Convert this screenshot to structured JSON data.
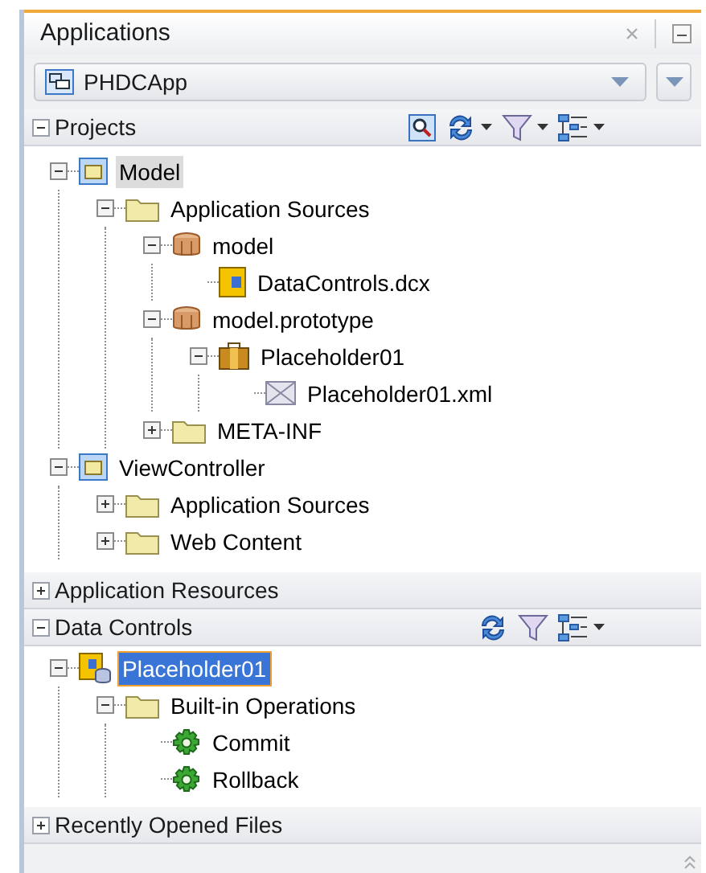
{
  "tab": {
    "title": "Applications"
  },
  "app_selector": {
    "value": "PHDCApp"
  },
  "sections": [
    {
      "title": "Projects",
      "expanded": true,
      "focused": false,
      "toolbar": [
        {
          "kind": "find",
          "menu": false
        },
        {
          "kind": "sync",
          "menu": true
        },
        {
          "kind": "filter",
          "menu": true
        },
        {
          "kind": "layout",
          "menu": true
        }
      ],
      "tree": [
        {
          "label": "Model",
          "kind": "project",
          "expanded": true,
          "selected": true,
          "children": [
            {
              "label": "Application Sources",
              "kind": "folder",
              "expanded": true,
              "selected": false,
              "children": [
                {
                  "label": "model",
                  "kind": "package",
                  "expanded": true,
                  "selected": false,
                  "children": [
                    {
                      "label": "DataControls.dcx",
                      "kind": "dcx",
                      "selected": false
                    }
                  ]
                },
                {
                  "label": "model.prototype",
                  "kind": "package",
                  "expanded": true,
                  "selected": false,
                  "children": [
                    {
                      "label": "Placeholder01",
                      "kind": "business",
                      "expanded": true,
                      "selected": false,
                      "children": [
                        {
                          "label": "Placeholder01.xml",
                          "kind": "xml",
                          "selected": false
                        }
                      ]
                    }
                  ]
                },
                {
                  "label": "META-INF",
                  "kind": "folder",
                  "expanded": false,
                  "selected": false
                }
              ]
            }
          ]
        },
        {
          "label": "ViewController",
          "kind": "project",
          "expanded": true,
          "selected": false,
          "children": [
            {
              "label": "Application Sources",
              "kind": "folder",
              "expanded": false,
              "selected": false
            },
            {
              "label": "Web Content",
              "kind": "folder",
              "expanded": false,
              "selected": false
            }
          ]
        }
      ]
    },
    {
      "title": "Application Resources",
      "expanded": false
    },
    {
      "title": "Data Controls",
      "expanded": true,
      "focused": true,
      "toolbar": [
        {
          "kind": "sync",
          "menu": false
        },
        {
          "kind": "filter",
          "menu": false
        },
        {
          "kind": "layout",
          "menu": true
        }
      ],
      "tree": [
        {
          "label": "Placeholder01",
          "kind": "datacontrol",
          "expanded": true,
          "selected": true,
          "children": [
            {
              "label": "Built-in Operations",
              "kind": "folder",
              "expanded": true,
              "selected": false,
              "children": [
                {
                  "label": "Commit",
                  "kind": "operation",
                  "selected": false
                },
                {
                  "label": "Rollback",
                  "kind": "operation",
                  "selected": false
                }
              ]
            }
          ]
        }
      ]
    },
    {
      "title": "Recently Opened Files",
      "expanded": false
    }
  ]
}
